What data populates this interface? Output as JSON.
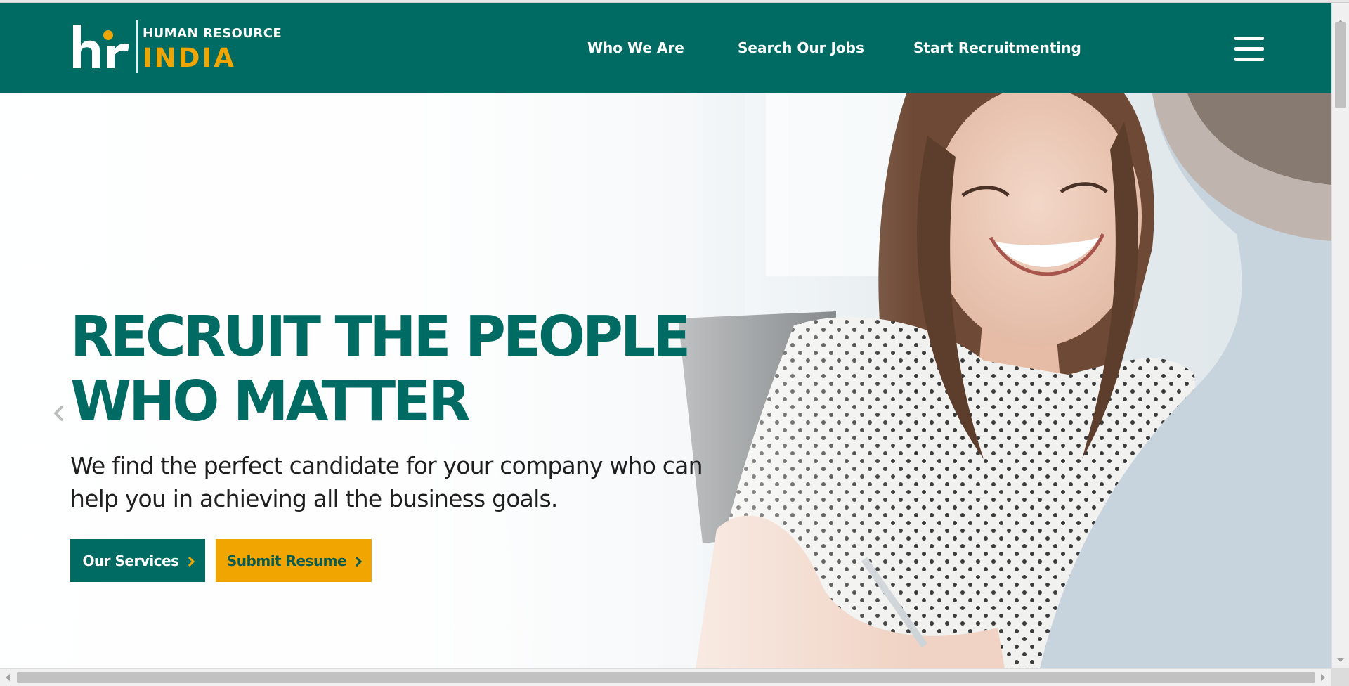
{
  "brand": {
    "logo_top": "HUMAN RESOURCE",
    "logo_bottom": "INDIA",
    "colors": {
      "primary": "#006b63",
      "accent": "#f0a500"
    }
  },
  "nav": {
    "items": [
      {
        "label": "Who We Are"
      },
      {
        "label": "Search Our Jobs"
      },
      {
        "label": "Start Recruitmenting"
      }
    ],
    "menu_icon": "hamburger-menu-icon"
  },
  "hero": {
    "headline_line1": "RECRUIT THE PEOPLE",
    "headline_line2": "WHO MATTER",
    "subtext_line1": "We find the perfect candidate for your company who can",
    "subtext_line2": "help you in achieving all the business goals.",
    "buttons": {
      "services": "Our Services",
      "resume": "Submit Resume"
    },
    "prev_icon": "chevron-left-icon"
  }
}
